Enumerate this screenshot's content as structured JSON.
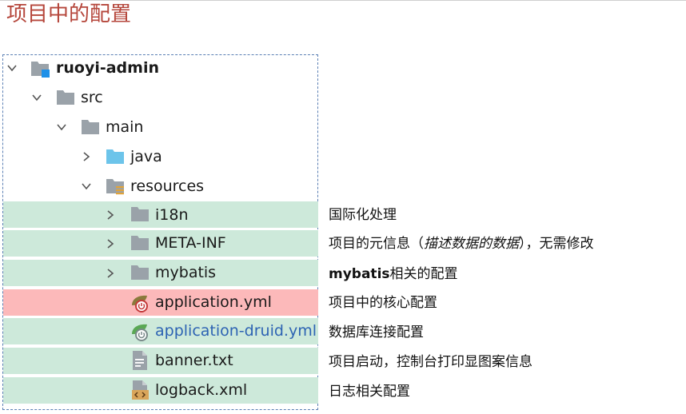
{
  "title": "项目中的配置",
  "tree": {
    "project": "ruoyi-admin",
    "src": "src",
    "main": "main",
    "java": "java",
    "resources": "resources",
    "i18n": "i18n",
    "meta_inf": "META-INF",
    "mybatis": "mybatis",
    "application": "application.yml",
    "application_druid": "application-druid.yml",
    "banner": "banner.txt",
    "logback": "logback.xml"
  },
  "descriptions": {
    "i18n": "国际化处理",
    "meta_inf_prefix": "项目的元信息（",
    "meta_inf_italic": "描述数据的数据",
    "meta_inf_suffix": "），无需修改",
    "mybatis_bold": "mybatis",
    "mybatis_rest": "相关的配置",
    "application": "项目中的核心配置",
    "application_druid": "数据库连接配置",
    "banner": "项目启动，控制台打印显图案信息",
    "logback": "日志相关配置"
  },
  "colors": {
    "title": "#b5463b",
    "highlight_green": "#cde9da",
    "highlight_red": "#fcb9ba",
    "folder_gray": "#9aa2a9",
    "folder_blue": "#6cc4ea",
    "link_blue": "#2d63b3"
  },
  "icons": {
    "expanded": "chevron-down-icon",
    "collapsed": "chevron-right-icon",
    "module": "module-folder-icon",
    "folder": "folder-icon",
    "source_folder": "source-folder-icon",
    "resource_folder": "resources-folder-icon",
    "yaml": "spring-yaml-icon",
    "text": "text-file-icon",
    "xml": "xml-file-icon"
  }
}
